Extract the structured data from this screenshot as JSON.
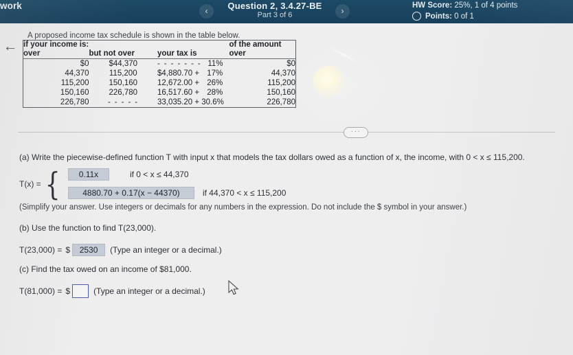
{
  "header": {
    "assignment_label": "work",
    "prev_icon": "chevron-left-icon",
    "next_icon": "chevron-right-icon",
    "prev_glyph": "‹",
    "next_glyph": "›",
    "question_title": "Question 2, 3.4.27-BE",
    "part_label": "Part 3 of 6",
    "hw_score": "HW Score: 25%, 1 of 4 points",
    "hw_score_prefix": "HW Score:",
    "hw_score_value": " 25%, 1 of 4 points",
    "points_prefix": "Points:",
    "points_value": " 0 of 1",
    "bg_color": "#1a4460"
  },
  "back_arrow_glyph": "←",
  "table": {
    "caption": "A proposed income tax schedule is shown in the table below.",
    "header_top_left": "if your income is:",
    "header_top_right": "of the amount",
    "columns": [
      "over",
      "but not over",
      "your tax is",
      "over"
    ],
    "rows": [
      {
        "over": "$0",
        "but_not_over": "$44,370",
        "tax_base": "",
        "tax_dots": "- - - - - - -",
        "tax_rate": "11%",
        "amount_over": "$0"
      },
      {
        "over": "44,370",
        "but_not_over": "115,200",
        "tax_base": "$4,880.70 +",
        "tax_dots": "",
        "tax_rate": "17%",
        "amount_over": "44,370"
      },
      {
        "over": "115,200",
        "but_not_over": "150,160",
        "tax_base": "12,672.00 +",
        "tax_dots": "",
        "tax_rate": "26%",
        "amount_over": "115,200"
      },
      {
        "over": "150,160",
        "but_not_over": "226,780",
        "tax_base": "16,517.60 +",
        "tax_dots": "",
        "tax_rate": "28%",
        "amount_over": "150,160"
      },
      {
        "over": "226,780",
        "but_not_over": "- - - - -",
        "tax_base": "33,035.20 + 30.6%",
        "tax_dots": "",
        "tax_rate": "",
        "amount_over": "226,780"
      }
    ]
  },
  "divider": {
    "ellipsis": "···"
  },
  "question": {
    "part_a_text": "(a) Write the piecewise-defined function T with input x that models the tax dollars owed as a function of x, the income, with 0 < x ≤ 115,200.",
    "function_label": "T(x) =",
    "cases": [
      {
        "expression": "0.11x",
        "condition": "if 0 < x ≤ 44,370"
      },
      {
        "expression": "4880.70 + 0.17(x − 44370)",
        "condition": "if 44,370 < x ≤ 115,200"
      }
    ],
    "note_a": "(Simplify your answer. Use integers or decimals for any numbers in the expression. Do not include the $ symbol in your answer.)",
    "part_b_text": "(b) Use the function to find T(23,000).",
    "answer_b_label": "T(23,000) =",
    "answer_b_dollar": "$",
    "answer_b_value": "2530",
    "answer_b_note": "(Type an integer or a decimal.)",
    "part_c_text": "(c) Find the tax owed on an income of $81,000.",
    "answer_c_label": "T(81,000) =",
    "answer_c_dollar": "$",
    "answer_c_value": "",
    "answer_c_note": "(Type an integer or a decimal.)"
  },
  "colors": {
    "header_bg": "#1a4460",
    "page_bg": "#eeeeef",
    "field_filled_bg": "#c6ccd6",
    "field_empty_border": "#4a5ca8"
  }
}
